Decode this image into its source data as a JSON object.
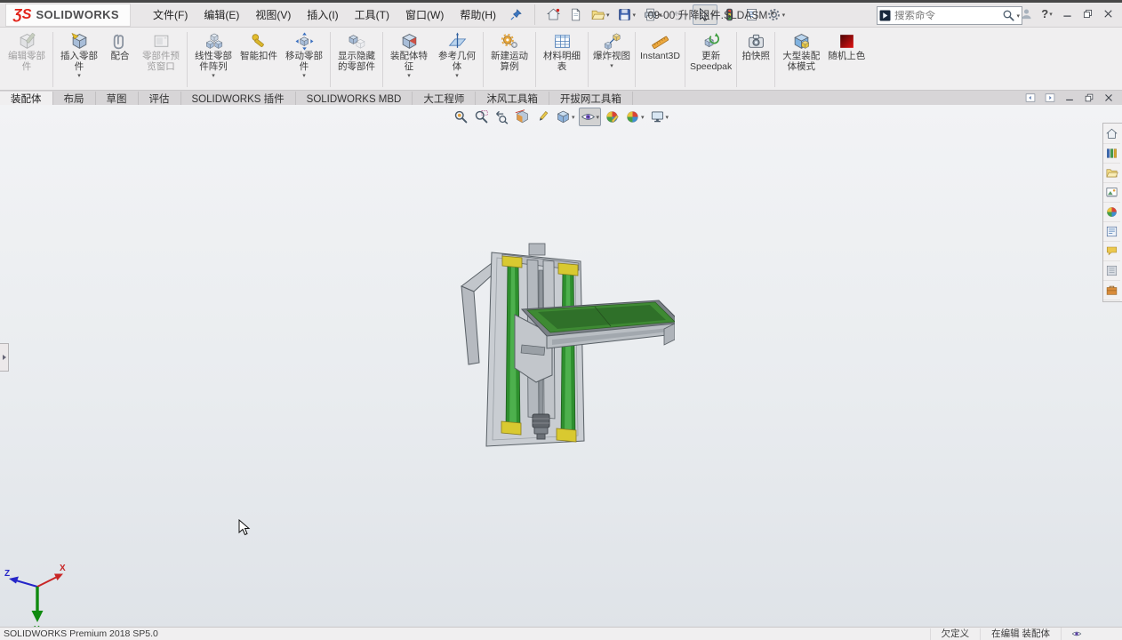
{
  "colors": {
    "brand_red": "#e2231a",
    "rail_green": "#2e8f2e",
    "tray_green": "#3e8a33",
    "accent_yellow": "#d9c930",
    "metal_gray": "#c9cdd2",
    "viewport_top": "#f2f3f5",
    "viewport_bottom": "#dfe3e8"
  },
  "titlebar": {
    "logo_mark": "ƷS",
    "brand": "SOLIDWORKS",
    "menus": [
      "文件(F)",
      "编辑(E)",
      "视图(V)",
      "插入(I)",
      "工具(T)",
      "窗口(W)",
      "帮助(H)"
    ],
    "title": "09-00 升降组件.SLDASM *",
    "search_placeholder": "搜索命令",
    "help_label": "?"
  },
  "quick_access": [
    {
      "name": "home",
      "icon": "home"
    },
    {
      "name": "new-document",
      "icon": "new-doc"
    },
    {
      "name": "open",
      "icon": "open",
      "dropdown": true
    },
    {
      "name": "save",
      "icon": "save",
      "dropdown": true
    },
    {
      "name": "print",
      "icon": "print",
      "dropdown": true
    },
    {
      "name": "undo",
      "icon": "undo",
      "dropdown": true,
      "disabled": true
    },
    {
      "name": "select",
      "icon": "select",
      "dropdown": true,
      "pressed": true
    },
    {
      "name": "rebuild",
      "icon": "rebuild"
    },
    {
      "name": "file-properties",
      "icon": "props"
    },
    {
      "name": "options",
      "icon": "gear",
      "dropdown": true
    }
  ],
  "ribbon": {
    "buttons": [
      {
        "id": "edit-component",
        "label": "编辑零部件",
        "icon": "edit-component",
        "disabled": true,
        "sep_after": true
      },
      {
        "id": "insert-components",
        "label": "插入零部件",
        "icon": "insert-component",
        "dropdown": true
      },
      {
        "id": "mate",
        "label": "配合",
        "icon": "mate"
      },
      {
        "id": "component-preview-window",
        "label": "零部件预览窗口",
        "icon": "preview-window",
        "disabled": true,
        "sep_after": true
      },
      {
        "id": "linear-component-pattern",
        "label": "线性零部件阵列",
        "icon": "linear-pattern",
        "dropdown": true
      },
      {
        "id": "smart-fasteners",
        "label": "智能扣件",
        "icon": "smart-fasteners"
      },
      {
        "id": "move-component",
        "label": "移动零部件",
        "icon": "move-component",
        "dropdown": true,
        "sep_after": true
      },
      {
        "id": "show-hidden-components",
        "label": "显示隐藏的零部件",
        "icon": "show-hidden",
        "sep_after": true
      },
      {
        "id": "assembly-features",
        "label": "装配体特征",
        "icon": "assembly-features",
        "dropdown": true
      },
      {
        "id": "reference-geometry",
        "label": "参考几何体",
        "icon": "reference-geometry",
        "dropdown": true,
        "sep_after": true
      },
      {
        "id": "new-motion-study",
        "label": "新建运动算例",
        "icon": "motion-study",
        "sep_after": true
      },
      {
        "id": "bill-of-materials",
        "label": "材料明细表",
        "icon": "bom",
        "sep_after": true
      },
      {
        "id": "exploded-view",
        "label": "爆炸视图",
        "icon": "exploded-view",
        "dropdown": true,
        "sep_after": true
      },
      {
        "id": "instant3d",
        "label": "Instant3D",
        "icon": "instant3d",
        "wide": true,
        "sep_after": true
      },
      {
        "id": "update-speedpak",
        "label": "更新\nSpeedpak",
        "icon": "speedpak",
        "wide": true,
        "sep_after": true
      },
      {
        "id": "take-snapshot",
        "label": "拍快照",
        "icon": "snapshot",
        "sep_after": true
      },
      {
        "id": "large-assembly-mode",
        "label": "大型装配体模式",
        "icon": "large-assembly"
      },
      {
        "id": "random-color",
        "label": "随机上色",
        "icon": "random-color"
      }
    ]
  },
  "tabs": {
    "active_index": 0,
    "items": [
      "装配体",
      "布局",
      "草图",
      "评估",
      "SOLIDWORKS 插件",
      "SOLIDWORKS MBD",
      "大工程师",
      "沐风工具箱",
      "开拔网工具箱"
    ]
  },
  "viewport_toolbar": [
    {
      "name": "zoom-to-fit",
      "icon": "zoom-fit"
    },
    {
      "name": "zoom-to-area",
      "icon": "zoom-area"
    },
    {
      "name": "previous-view",
      "icon": "prev-view"
    },
    {
      "name": "section-view",
      "icon": "section"
    },
    {
      "name": "annotation-views",
      "icon": "annot"
    },
    {
      "name": "view-orientation",
      "icon": "view-cube",
      "dropdown": true
    },
    {
      "name": "hide-show-items",
      "icon": "eye",
      "dropdown": true,
      "active": true
    },
    {
      "name": "edit-appearance",
      "icon": "appearance-edit"
    },
    {
      "name": "apply-scene",
      "icon": "scene",
      "dropdown": true
    },
    {
      "name": "view-settings",
      "icon": "monitor",
      "dropdown": true
    }
  ],
  "task_pane": [
    {
      "name": "solidworks-resources",
      "icon": "tp-home"
    },
    {
      "name": "design-library",
      "icon": "tp-library"
    },
    {
      "name": "file-explorer",
      "icon": "tp-folder"
    },
    {
      "name": "view-palette",
      "icon": "tp-palette"
    },
    {
      "name": "appearances-scenes",
      "icon": "tp-sphere"
    },
    {
      "name": "custom-properties",
      "icon": "tp-props"
    },
    {
      "name": "solidworks-forum",
      "icon": "tp-forum"
    },
    {
      "name": "sw-addins",
      "icon": "tp-addin"
    },
    {
      "name": "toolbox",
      "icon": "tp-toolbox"
    }
  ],
  "doc_controls": [
    {
      "name": "show-feature-pane",
      "icon": "pane-left"
    },
    {
      "name": "show-display-pane",
      "icon": "pane-right"
    },
    {
      "name": "doc-minimize",
      "icon": "win-min"
    },
    {
      "name": "doc-restore",
      "icon": "win-restore"
    },
    {
      "name": "doc-close",
      "icon": "win-close"
    }
  ],
  "window_controls": [
    {
      "name": "user-login",
      "icon": "user"
    },
    {
      "name": "help",
      "icon": "help",
      "dropdown": true
    },
    {
      "name": "minimize",
      "icon": "win-min"
    },
    {
      "name": "maximize",
      "icon": "win-restore"
    },
    {
      "name": "close",
      "icon": "win-close"
    }
  ],
  "status": {
    "product": "SOLIDWORKS Premium 2018 SP5.0",
    "definition_state": "欠定义",
    "editing_state": "在编辑 装配体"
  },
  "triad": {
    "x_label": "X",
    "y_label": "Y",
    "z_label": "Z"
  }
}
